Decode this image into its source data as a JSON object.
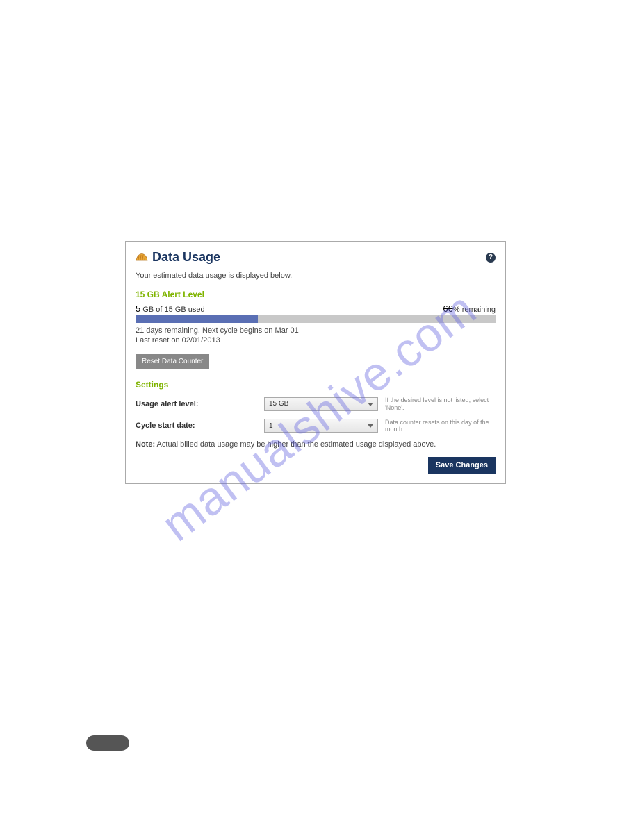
{
  "panel": {
    "title": "Data Usage",
    "description": "Your estimated data usage is displayed below.",
    "alert_level_label": "15 GB Alert Level",
    "used_num": "5",
    "used_rest": " GB of 15 GB used",
    "remaining_num": "66",
    "remaining_rest": "% remaining",
    "progress_percent": 34,
    "cycle_line1": "21 days remaining. Next cycle begins on Mar 01",
    "cycle_line2": "Last reset on 02/01/2013",
    "reset_button": "Reset Data Counter",
    "settings_heading": "Settings",
    "settings": {
      "usage_alert": {
        "label": "Usage alert level:",
        "value": "15 GB",
        "hint": "If the desired level is not listed, select 'None'."
      },
      "cycle_start": {
        "label": "Cycle start date:",
        "value": "1",
        "hint": "Data counter resets on this day of the month."
      }
    },
    "note_label": "Note:",
    "note_text": " Actual billed data usage may be higher than the estimated usage displayed above.",
    "save_button": "Save Changes"
  },
  "watermark": "manualshive.com"
}
